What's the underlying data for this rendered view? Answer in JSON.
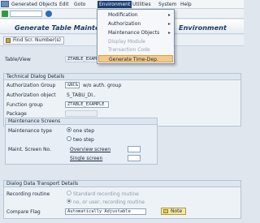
{
  "menubar": {
    "items": [
      "Generated Objects",
      "Edit",
      "Goto",
      "Environment",
      "Utilities",
      "System",
      "Help"
    ],
    "active": "Environment"
  },
  "title": "Generate Table Maintenance Dialog: Generation Environment",
  "title_visible_left": "Generate Table Maintenan",
  "title_visible_right": "Environment",
  "apptoolbar": {
    "find_button": "Find Scr. Number(s)"
  },
  "table_view": {
    "label": "Table/View",
    "value": "ZTABLE_EXAMPLE"
  },
  "technical": {
    "title": "Technical Dialog Details",
    "auth_group_label": "Authorization Group",
    "auth_group_value": "&NC&",
    "auth_group_desc": "w/o auth. group",
    "auth_object_label": "Authorization object",
    "auth_object_value": "S_TABU_DI..",
    "function_group_label": "Function group",
    "function_group_value": "ZTABLE_EXAMPLE",
    "package_label": "Package",
    "package_value": ""
  },
  "maintenance": {
    "title": "Maintenance Screens",
    "type_label": "Maintenance type",
    "option_one": "one step",
    "option_two": "two step",
    "screen_no_label": "Maint. Screen No.",
    "overview_label": "Overview screen",
    "overview_value": "",
    "single_label": "Single screen",
    "single_value": ""
  },
  "transport": {
    "title": "Dialog Data Transport Details",
    "recording_label": "Recording routine",
    "option_standard": "Standard recording routine",
    "option_no": "no, or user, recording routine",
    "compare_label": "Compare Flag",
    "compare_value": "Automatically Adjustable",
    "note_button": "Note"
  },
  "dropdown": {
    "items": [
      {
        "label": "Modification",
        "submenu": true,
        "disabled": false
      },
      {
        "label": "Authorization",
        "submenu": true,
        "disabled": false
      },
      {
        "label": "Maintenance Objects",
        "submenu": true,
        "disabled": false
      },
      {
        "label": "Display Module",
        "submenu": false,
        "disabled": true
      },
      {
        "label": "Transaction Code",
        "submenu": false,
        "disabled": true
      },
      {
        "label": "Generate Time-Dep.",
        "submenu": false,
        "disabled": false
      }
    ],
    "arrow": "▸"
  }
}
